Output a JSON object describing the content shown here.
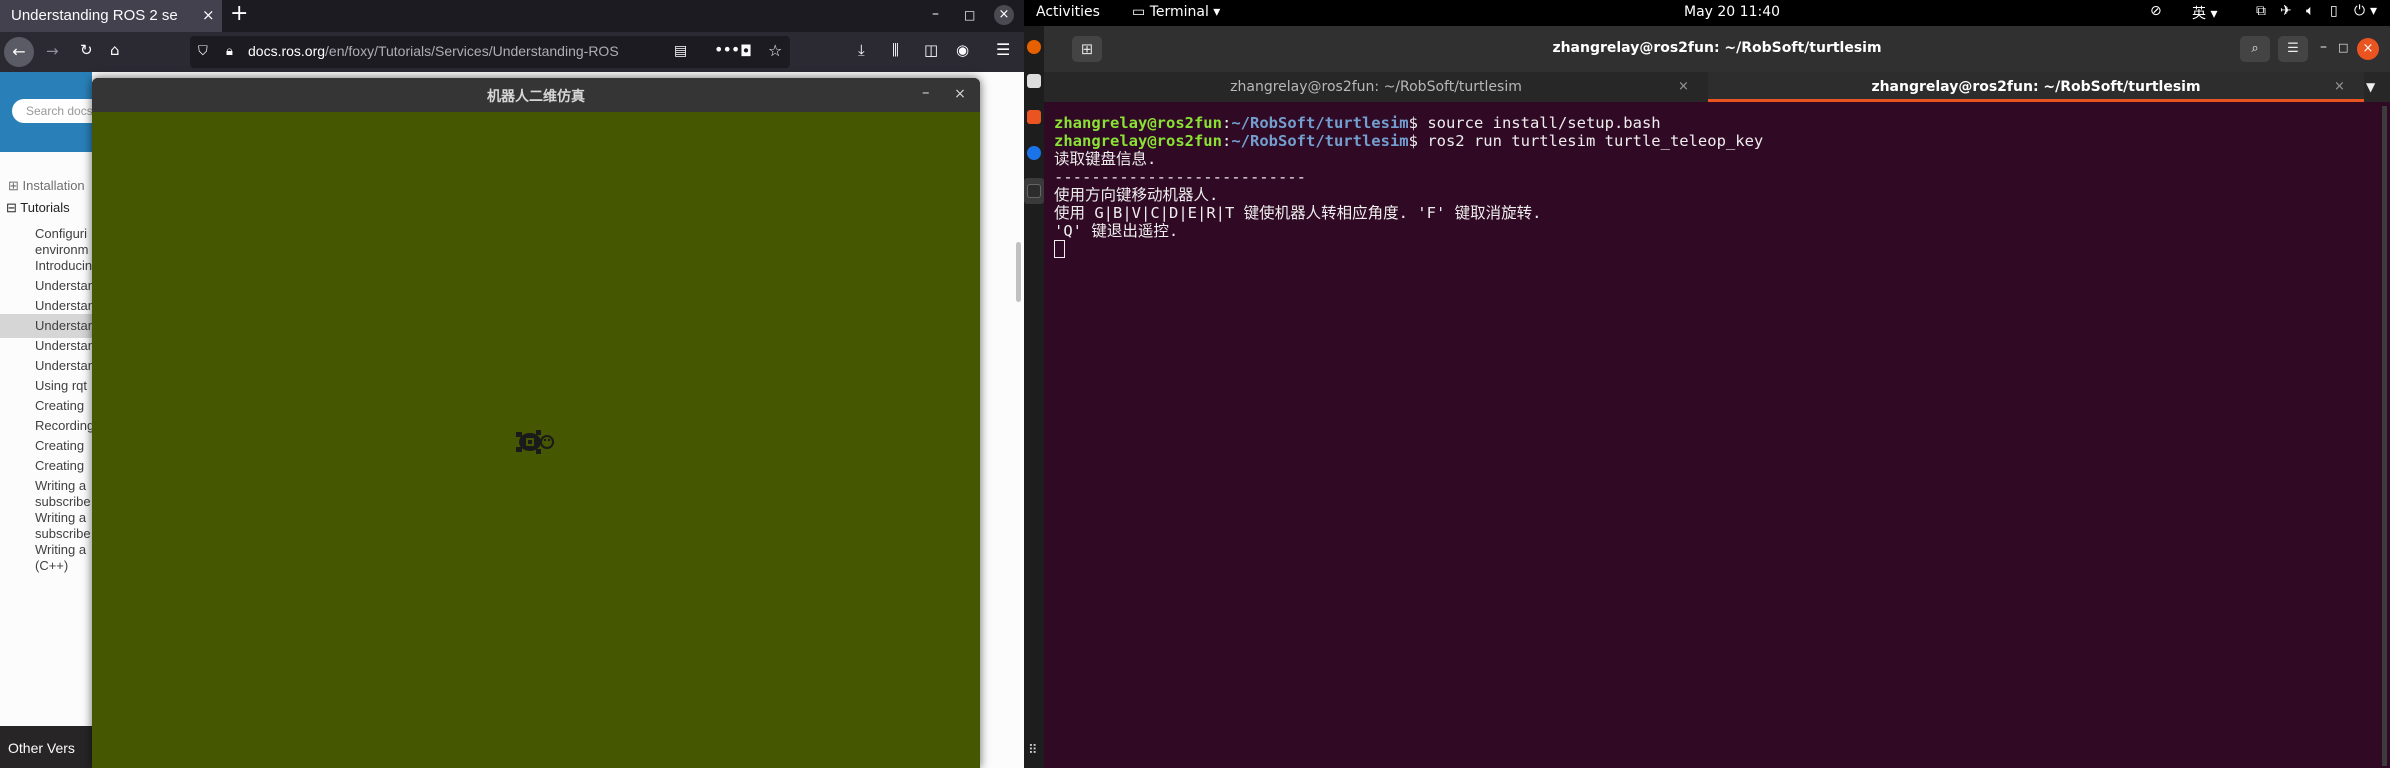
{
  "firefox": {
    "tab_title": "Understanding ROS 2 se",
    "tab_close": "×",
    "new_tab": "+",
    "url_host": "docs.ros.org",
    "url_path": "/en/foxy/Tutorials/Services/Understanding-ROS",
    "controls": {
      "minimize": "–",
      "maximize": "□",
      "close": "×"
    }
  },
  "docs": {
    "search_placeholder": "Search docs",
    "sidebar": {
      "installation": "Installation",
      "tutorials": "Tutorials",
      "items": [
        {
          "line1": "Configuri",
          "line2": "environm"
        },
        {
          "line1": "Introducin",
          "line2": ""
        },
        {
          "line1": "Understan",
          "line2": ""
        },
        {
          "line1": "Understan",
          "line2": ""
        },
        {
          "line1": "Understan",
          "line2": ""
        },
        {
          "line1": "Understan",
          "line2": ""
        },
        {
          "line1": "Understan",
          "line2": ""
        },
        {
          "line1": "Using rqt",
          "line2": ""
        },
        {
          "line1": "Creating",
          "line2": ""
        },
        {
          "line1": "Recording",
          "line2": ""
        },
        {
          "line1": "Creating",
          "line2": ""
        },
        {
          "line1": "Creating",
          "line2": ""
        },
        {
          "line1": "Writing a",
          "line2": "subscribe"
        },
        {
          "line1": "Writing a",
          "line2": "subscribe"
        },
        {
          "line1": "Writing a",
          "line2": "(C++)"
        }
      ],
      "active_index": 4
    },
    "footer": "Other Vers"
  },
  "turtlesim": {
    "title": "机器人二维仿真",
    "minimize": "–",
    "close": "×",
    "background_color": "#455700"
  },
  "gnome": {
    "activities": "Activities",
    "app_menu": "Terminal ▾",
    "clock": "May 20  11:40",
    "input_method": "英 ▾",
    "status_icons": [
      "network-icon",
      "airplane-icon",
      "volume-icon",
      "battery-icon",
      "power-icon"
    ]
  },
  "terminal": {
    "window_title": "zhangrelay@ros2fun: ~/RobSoft/turtlesim",
    "tabs": [
      {
        "label": "zhangrelay@ros2fun: ~/RobSoft/turtlesim",
        "active": false
      },
      {
        "label": "zhangrelay@ros2fun: ~/RobSoft/turtlesim",
        "active": true
      }
    ],
    "lines": [
      {
        "user": "zhangrelay@ros2fun",
        "path": "~/RobSoft/turtlesim",
        "cmd": "source install/setup.bash"
      },
      {
        "user": "zhangrelay@ros2fun",
        "path": "~/RobSoft/turtlesim",
        "cmd": "ros2 run turtlesim turtle_teleop_key"
      }
    ],
    "output": [
      "读取键盘信息.",
      "---------------------------",
      "使用方向键移动机器人.",
      "使用 G|B|V|C|D|E|R|T 键使机器人转相应角度. 'F' 键取消旋转.",
      "'Q' 键退出遥控."
    ]
  }
}
